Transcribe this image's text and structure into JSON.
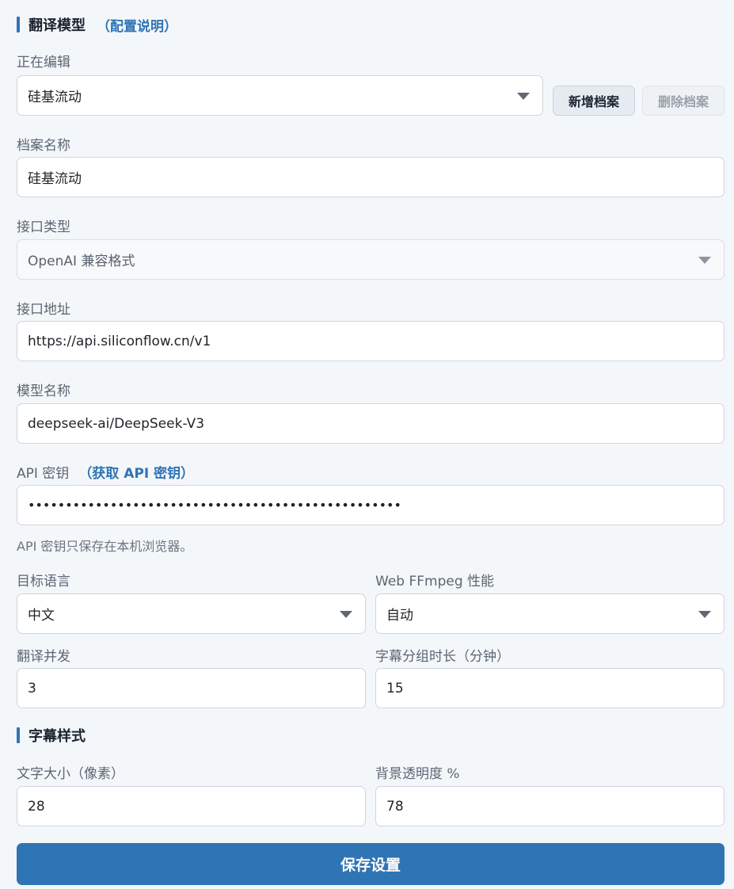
{
  "model_section": {
    "title": "翻译模型",
    "config_link": "（配置说明）"
  },
  "editing": {
    "label": "正在编辑",
    "selected": "硅基流动",
    "add_button": "新增档案",
    "delete_button": "删除档案"
  },
  "profile_name": {
    "label": "档案名称",
    "value": "硅基流动"
  },
  "api_type": {
    "label": "接口类型",
    "selected": "OpenAI 兼容格式"
  },
  "api_url": {
    "label": "接口地址",
    "value": "https://api.siliconflow.cn/v1"
  },
  "model_name": {
    "label": "模型名称",
    "value": "deepseek-ai/DeepSeek-V3"
  },
  "api_key": {
    "label": "API 密钥",
    "get_link": "（获取 API 密钥）",
    "masked_value": "••••••••••••••••••••••••••••••••••••••••••••••••••",
    "hint": "API 密钥只保存在本机浏览器。"
  },
  "target_language": {
    "label": "目标语言",
    "selected": "中文"
  },
  "ffmpeg": {
    "label": "Web FFmpeg 性能",
    "selected": "自动"
  },
  "concurrency": {
    "label": "翻译并发",
    "value": "3"
  },
  "group_duration": {
    "label": "字幕分组时长（分钟）",
    "value": "15"
  },
  "style_section": {
    "title": "字幕样式"
  },
  "font_size": {
    "label": "文字大小（像素）",
    "value": "28"
  },
  "bg_opacity": {
    "label": "背景透明度 %",
    "value": "78"
  },
  "save_button": "保存设置",
  "colors": {
    "accent": "#2f74b5",
    "background": "#f4f7fa"
  }
}
